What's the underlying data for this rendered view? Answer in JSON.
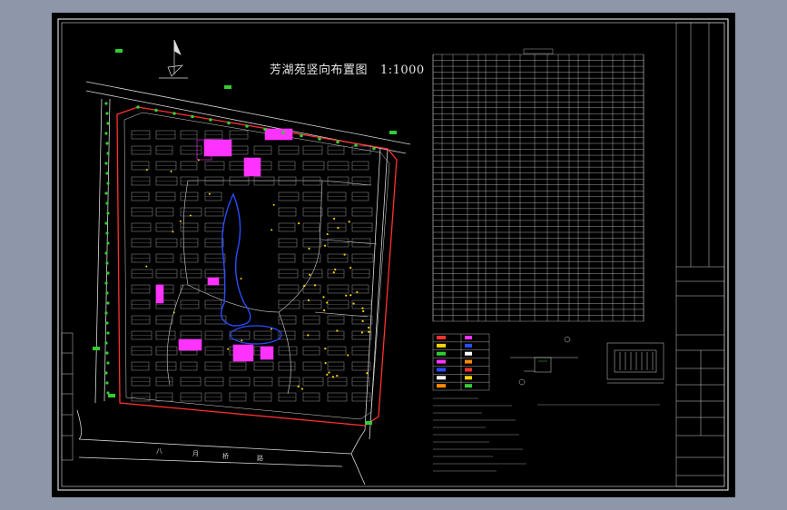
{
  "drawing": {
    "title": "芳湖苑竖向布置图",
    "scale": "1:1000",
    "road_name": [
      "八",
      "月",
      "桥",
      "路"
    ]
  },
  "colors": {
    "background": "#000000",
    "frame": "#ffffff",
    "road": "#d8d8d8",
    "boundary": "#ff3030",
    "building": "#9a9a9a",
    "landscape": "#ff33ff",
    "water": "#2a4cff",
    "tree": "#33cc33",
    "marker": "#ffd400",
    "table_lines": "#cfcfcf"
  },
  "table": {
    "rows": 45,
    "column_groups": 4
  },
  "legend": {
    "rows": 7,
    "columns": 2
  },
  "icons": [
    "north-arrow-icon",
    "drainage-section-icon",
    "grate-detail-icon"
  ]
}
